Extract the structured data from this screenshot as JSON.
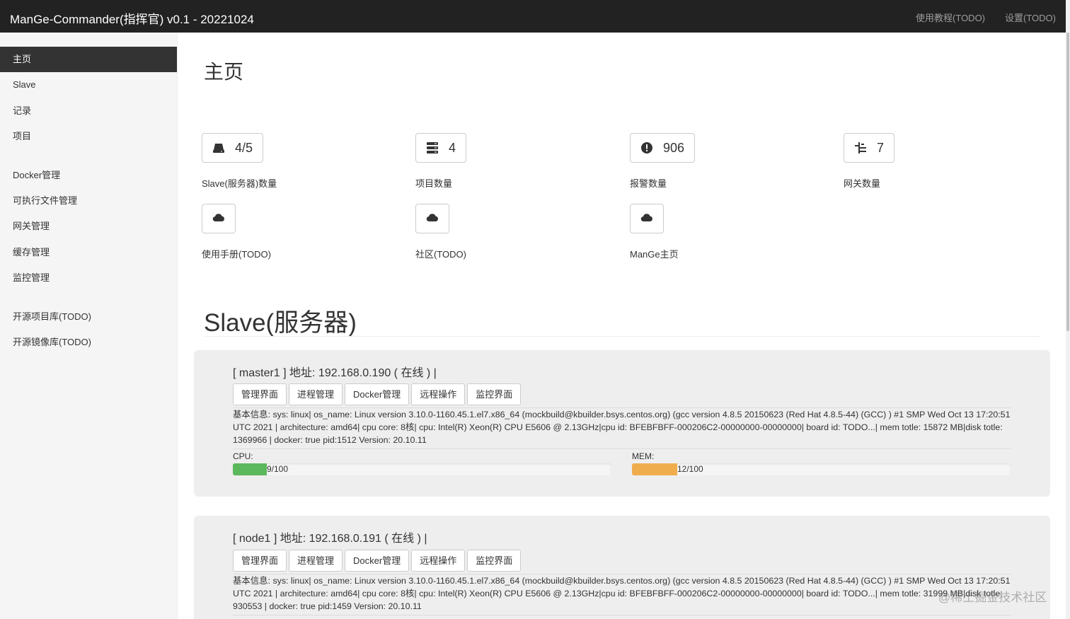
{
  "header": {
    "title": "ManGe-Commander(指挥官) v0.1 - 20221024",
    "nav": [
      "使用教程(TODO)",
      "设置(TODO)"
    ]
  },
  "sidebar": {
    "active_index": 0,
    "items": [
      {
        "label": "主页"
      },
      {
        "label": "Slave"
      },
      {
        "label": "记录"
      },
      {
        "label": "项目"
      },
      {
        "label": "Docker管理"
      },
      {
        "label": "可执行文件管理"
      },
      {
        "label": "网关管理"
      },
      {
        "label": "缓存管理"
      },
      {
        "label": "监控管理"
      },
      {
        "label": "开源项目库(TODO)"
      },
      {
        "label": "开源镜像库(TODO)"
      }
    ]
  },
  "main": {
    "title": "主页",
    "stats": [
      {
        "icon": "hdd-icon",
        "value": "4/5",
        "label": "Slave(服务器)数量"
      },
      {
        "icon": "server-stack-icon",
        "value": "4",
        "label": "项目数量"
      },
      {
        "icon": "alert-icon",
        "value": "906",
        "label": "报警数量"
      },
      {
        "icon": "tree-icon",
        "value": "7",
        "label": "网关数量"
      }
    ],
    "links": [
      {
        "icon": "cloud-icon",
        "label": "使用手册(TODO)"
      },
      {
        "icon": "cloud-icon",
        "label": "社区(TODO)"
      },
      {
        "icon": "cloud-icon",
        "label": "ManGe主页"
      }
    ],
    "slave_section_title": "Slave(服务器)"
  },
  "slaves": [
    {
      "title": "[ master1 ] 地址: 192.168.0.190 ( 在线 ) |",
      "buttons": [
        "管理界面",
        "进程管理",
        "Docker管理",
        "远程操作",
        "监控界面"
      ],
      "info": "基本信息: sys: linux| os_name: Linux version 3.10.0-1160.45.1.el7.x86_64 (mockbuild@kbuilder.bsys.centos.org) (gcc version 4.8.5 20150623 (Red Hat 4.8.5-44) (GCC) ) #1 SMP Wed Oct 13 17:20:51 UTC 2021 | architecture: amd64| cpu core: 8核| cpu: Intel(R) Xeon(R) CPU E5606 @ 2.13GHz|cpu id: BFEBFBFF-000206C2-00000000-00000000| board id: TODO...| mem totle: 15872 MB|disk totle: 1369966 | docker: true pid:1512 Version: 20.10.11",
      "cpu_label": "CPU:",
      "cpu_value": 9,
      "cpu_text": "9/100",
      "mem_label": "MEM:",
      "mem_value": 12,
      "mem_text": "12/100"
    },
    {
      "title": "[ node1 ] 地址: 192.168.0.191 ( 在线 ) |",
      "buttons": [
        "管理界面",
        "进程管理",
        "Docker管理",
        "远程操作",
        "监控界面"
      ],
      "info": "基本信息: sys: linux| os_name: Linux version 3.10.0-1160.45.1.el7.x86_64 (mockbuild@kbuilder.bsys.centos.org) (gcc version 4.8.5 20150623 (Red Hat 4.8.5-44) (GCC) ) #1 SMP Wed Oct 13 17:20:51 UTC 2021 | architecture: amd64| cpu core: 8核| cpu: Intel(R) Xeon(R) CPU E5606 @ 2.13GHz|cpu id: BFEBFBFF-000206C2-00000000-00000000| board id: TODO...| mem totle: 31999 MB|disk totle: 930553 | docker: true pid:1459 Version: 20.10.11"
    }
  ],
  "colors": {
    "cpu_bar": "#5cb85c",
    "mem_bar": "#f0ad4e",
    "topbar": "#222222",
    "sidebar_active": "#333333"
  },
  "watermark": "@稀土掘金技术社区"
}
